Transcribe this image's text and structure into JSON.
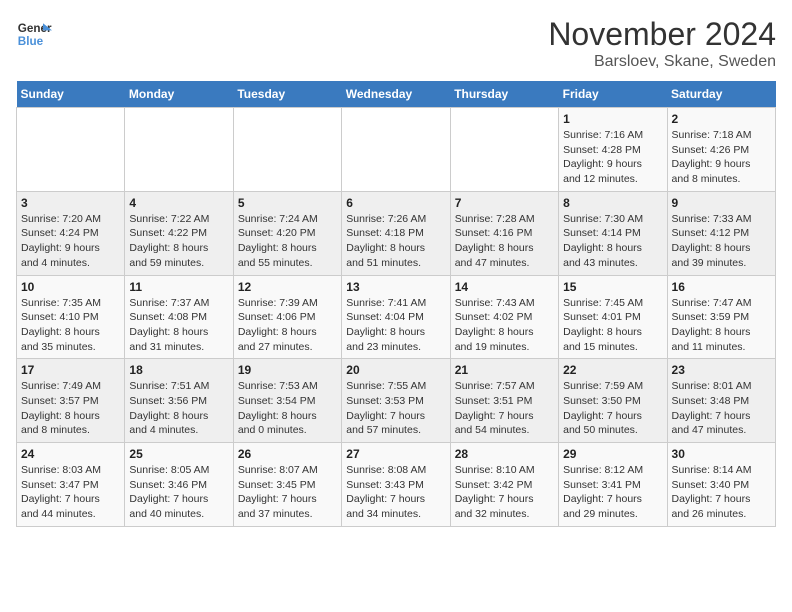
{
  "logo": {
    "line1": "General",
    "line2": "Blue"
  },
  "title": "November 2024",
  "location": "Barsloev, Skane, Sweden",
  "days_header": [
    "Sunday",
    "Monday",
    "Tuesday",
    "Wednesday",
    "Thursday",
    "Friday",
    "Saturday"
  ],
  "weeks": [
    [
      {
        "day": "",
        "info": ""
      },
      {
        "day": "",
        "info": ""
      },
      {
        "day": "",
        "info": ""
      },
      {
        "day": "",
        "info": ""
      },
      {
        "day": "",
        "info": ""
      },
      {
        "day": "1",
        "info": "Sunrise: 7:16 AM\nSunset: 4:28 PM\nDaylight: 9 hours\nand 12 minutes."
      },
      {
        "day": "2",
        "info": "Sunrise: 7:18 AM\nSunset: 4:26 PM\nDaylight: 9 hours\nand 8 minutes."
      }
    ],
    [
      {
        "day": "3",
        "info": "Sunrise: 7:20 AM\nSunset: 4:24 PM\nDaylight: 9 hours\nand 4 minutes."
      },
      {
        "day": "4",
        "info": "Sunrise: 7:22 AM\nSunset: 4:22 PM\nDaylight: 8 hours\nand 59 minutes."
      },
      {
        "day": "5",
        "info": "Sunrise: 7:24 AM\nSunset: 4:20 PM\nDaylight: 8 hours\nand 55 minutes."
      },
      {
        "day": "6",
        "info": "Sunrise: 7:26 AM\nSunset: 4:18 PM\nDaylight: 8 hours\nand 51 minutes."
      },
      {
        "day": "7",
        "info": "Sunrise: 7:28 AM\nSunset: 4:16 PM\nDaylight: 8 hours\nand 47 minutes."
      },
      {
        "day": "8",
        "info": "Sunrise: 7:30 AM\nSunset: 4:14 PM\nDaylight: 8 hours\nand 43 minutes."
      },
      {
        "day": "9",
        "info": "Sunrise: 7:33 AM\nSunset: 4:12 PM\nDaylight: 8 hours\nand 39 minutes."
      }
    ],
    [
      {
        "day": "10",
        "info": "Sunrise: 7:35 AM\nSunset: 4:10 PM\nDaylight: 8 hours\nand 35 minutes."
      },
      {
        "day": "11",
        "info": "Sunrise: 7:37 AM\nSunset: 4:08 PM\nDaylight: 8 hours\nand 31 minutes."
      },
      {
        "day": "12",
        "info": "Sunrise: 7:39 AM\nSunset: 4:06 PM\nDaylight: 8 hours\nand 27 minutes."
      },
      {
        "day": "13",
        "info": "Sunrise: 7:41 AM\nSunset: 4:04 PM\nDaylight: 8 hours\nand 23 minutes."
      },
      {
        "day": "14",
        "info": "Sunrise: 7:43 AM\nSunset: 4:02 PM\nDaylight: 8 hours\nand 19 minutes."
      },
      {
        "day": "15",
        "info": "Sunrise: 7:45 AM\nSunset: 4:01 PM\nDaylight: 8 hours\nand 15 minutes."
      },
      {
        "day": "16",
        "info": "Sunrise: 7:47 AM\nSunset: 3:59 PM\nDaylight: 8 hours\nand 11 minutes."
      }
    ],
    [
      {
        "day": "17",
        "info": "Sunrise: 7:49 AM\nSunset: 3:57 PM\nDaylight: 8 hours\nand 8 minutes."
      },
      {
        "day": "18",
        "info": "Sunrise: 7:51 AM\nSunset: 3:56 PM\nDaylight: 8 hours\nand 4 minutes."
      },
      {
        "day": "19",
        "info": "Sunrise: 7:53 AM\nSunset: 3:54 PM\nDaylight: 8 hours\nand 0 minutes."
      },
      {
        "day": "20",
        "info": "Sunrise: 7:55 AM\nSunset: 3:53 PM\nDaylight: 7 hours\nand 57 minutes."
      },
      {
        "day": "21",
        "info": "Sunrise: 7:57 AM\nSunset: 3:51 PM\nDaylight: 7 hours\nand 54 minutes."
      },
      {
        "day": "22",
        "info": "Sunrise: 7:59 AM\nSunset: 3:50 PM\nDaylight: 7 hours\nand 50 minutes."
      },
      {
        "day": "23",
        "info": "Sunrise: 8:01 AM\nSunset: 3:48 PM\nDaylight: 7 hours\nand 47 minutes."
      }
    ],
    [
      {
        "day": "24",
        "info": "Sunrise: 8:03 AM\nSunset: 3:47 PM\nDaylight: 7 hours\nand 44 minutes."
      },
      {
        "day": "25",
        "info": "Sunrise: 8:05 AM\nSunset: 3:46 PM\nDaylight: 7 hours\nand 40 minutes."
      },
      {
        "day": "26",
        "info": "Sunrise: 8:07 AM\nSunset: 3:45 PM\nDaylight: 7 hours\nand 37 minutes."
      },
      {
        "day": "27",
        "info": "Sunrise: 8:08 AM\nSunset: 3:43 PM\nDaylight: 7 hours\nand 34 minutes."
      },
      {
        "day": "28",
        "info": "Sunrise: 8:10 AM\nSunset: 3:42 PM\nDaylight: 7 hours\nand 32 minutes."
      },
      {
        "day": "29",
        "info": "Sunrise: 8:12 AM\nSunset: 3:41 PM\nDaylight: 7 hours\nand 29 minutes."
      },
      {
        "day": "30",
        "info": "Sunrise: 8:14 AM\nSunset: 3:40 PM\nDaylight: 7 hours\nand 26 minutes."
      }
    ]
  ]
}
